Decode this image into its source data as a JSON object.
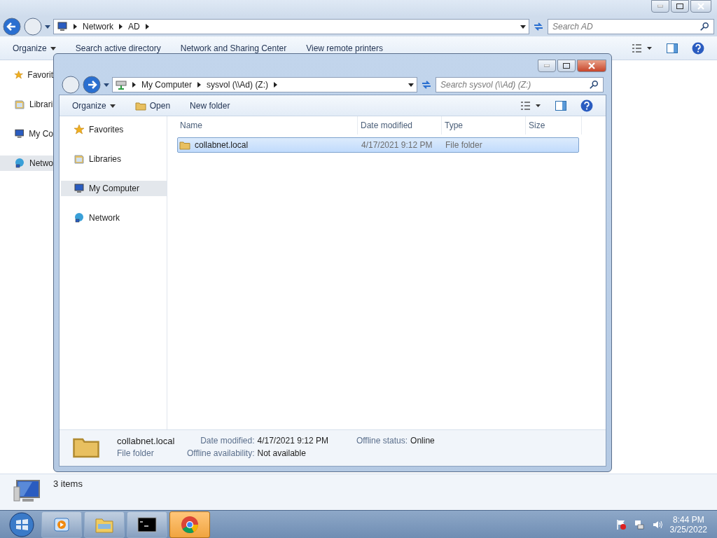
{
  "back_window": {
    "address": [
      "Network",
      "AD"
    ],
    "search": {
      "placeholder": "Search AD"
    },
    "toolbar": [
      "Organize",
      "Search active directory",
      "Network and Sharing Center",
      "View remote printers"
    ],
    "sidebar": [
      {
        "label": "Favorit",
        "kind": "star",
        "selected": false
      },
      {
        "label": "Librari",
        "kind": "library",
        "selected": false
      },
      {
        "label": "My Co",
        "kind": "computer",
        "selected": false
      },
      {
        "label": "Netwo",
        "kind": "network",
        "selected": true
      }
    ],
    "details": "3 items"
  },
  "front_window": {
    "address": [
      "My Computer",
      "sysvol (\\\\Ad) (Z:)"
    ],
    "search": {
      "placeholder": "Search sysvol (\\\\Ad) (Z:)"
    },
    "toolbar": [
      {
        "label": "Organize",
        "kind": "menu"
      },
      {
        "label": "Open",
        "kind": "open"
      },
      {
        "label": "New folder",
        "kind": "plain"
      }
    ],
    "sidebar": [
      {
        "label": "Favorites",
        "kind": "star",
        "selected": false
      },
      {
        "label": "Libraries",
        "kind": "library",
        "selected": false
      },
      {
        "label": "My Computer",
        "kind": "computer",
        "selected": true
      },
      {
        "label": "Network",
        "kind": "network",
        "selected": false
      }
    ],
    "columns": [
      "Name",
      "Date modified",
      "Type",
      "Size"
    ],
    "rows": [
      {
        "name": "collabnet.local",
        "date": "4/17/2021 9:12 PM",
        "type": "File folder",
        "selected": true
      }
    ],
    "details": {
      "name": "collabnet.local",
      "type": "File folder",
      "fields": [
        {
          "label": "Date modified:",
          "value": "4/17/2021 9:12 PM"
        },
        {
          "label": "Offline status:",
          "value": "Online"
        },
        {
          "label": "Offline availability:",
          "value": "Not available"
        }
      ]
    }
  },
  "taskbar": {
    "buttons": [
      {
        "kind": "media",
        "selected": false
      },
      {
        "kind": "explorer",
        "selected": false
      },
      {
        "kind": "console",
        "selected": false
      },
      {
        "kind": "browser",
        "selected": true
      }
    ],
    "clock": {
      "time": "8:44 PM",
      "date": "3/25/2022"
    }
  }
}
